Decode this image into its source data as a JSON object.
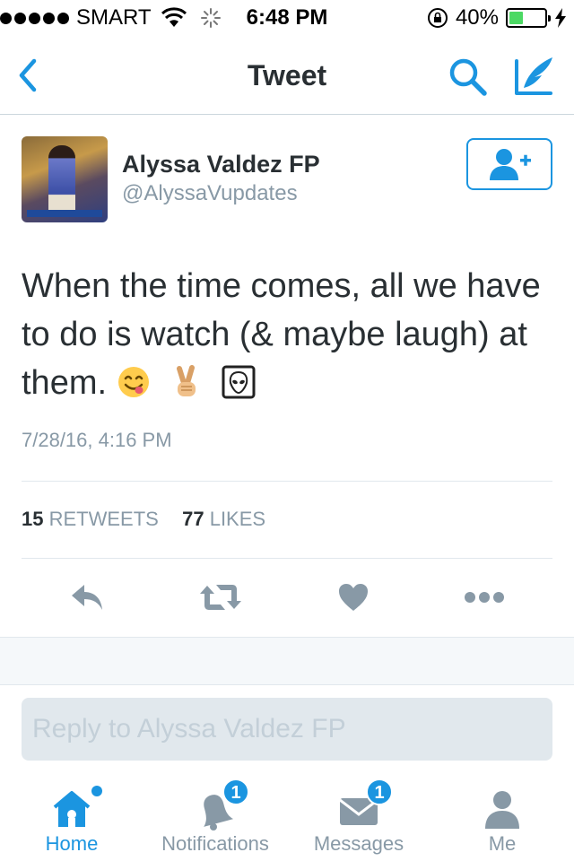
{
  "status_bar": {
    "carrier": "SMART",
    "time": "6:48 PM",
    "battery": "40%",
    "battery_level": 0.4
  },
  "nav": {
    "title": "Tweet",
    "icons": [
      "back-chevron-icon",
      "search-icon",
      "compose-tweet-icon"
    ]
  },
  "tweet": {
    "author_name": "Alyssa Valdez FP",
    "author_handle": "@AlyssaVupdates",
    "text": "When the time comes, all we have to do is watch (& maybe laugh) at them.",
    "emojis": [
      "yum-face-emoji",
      "victory-hand-emoji",
      "alien-face-emoji"
    ],
    "date": "7/28/16, 4:16 PM",
    "retweet_count": "15",
    "retweet_label": "RETWEETS",
    "like_count": "77",
    "like_label": "LIKES"
  },
  "actions": [
    "reply-icon",
    "retweet-icon",
    "like-heart-icon",
    "more-dots-icon"
  ],
  "reply": {
    "placeholder": "Reply to Alyssa Valdez FP"
  },
  "tabbar": {
    "items": [
      {
        "label": "Home",
        "icon": "home-icon",
        "active": true
      },
      {
        "label": "Notifications",
        "icon": "bell-icon",
        "badge": "1"
      },
      {
        "label": "Messages",
        "icon": "envelope-icon",
        "badge": "1"
      },
      {
        "label": "Me",
        "icon": "person-icon"
      }
    ]
  },
  "colors": {
    "accent": "#1b95e0",
    "text": "#292f33",
    "muted": "#8899a6",
    "border": "#e1e8ed"
  }
}
